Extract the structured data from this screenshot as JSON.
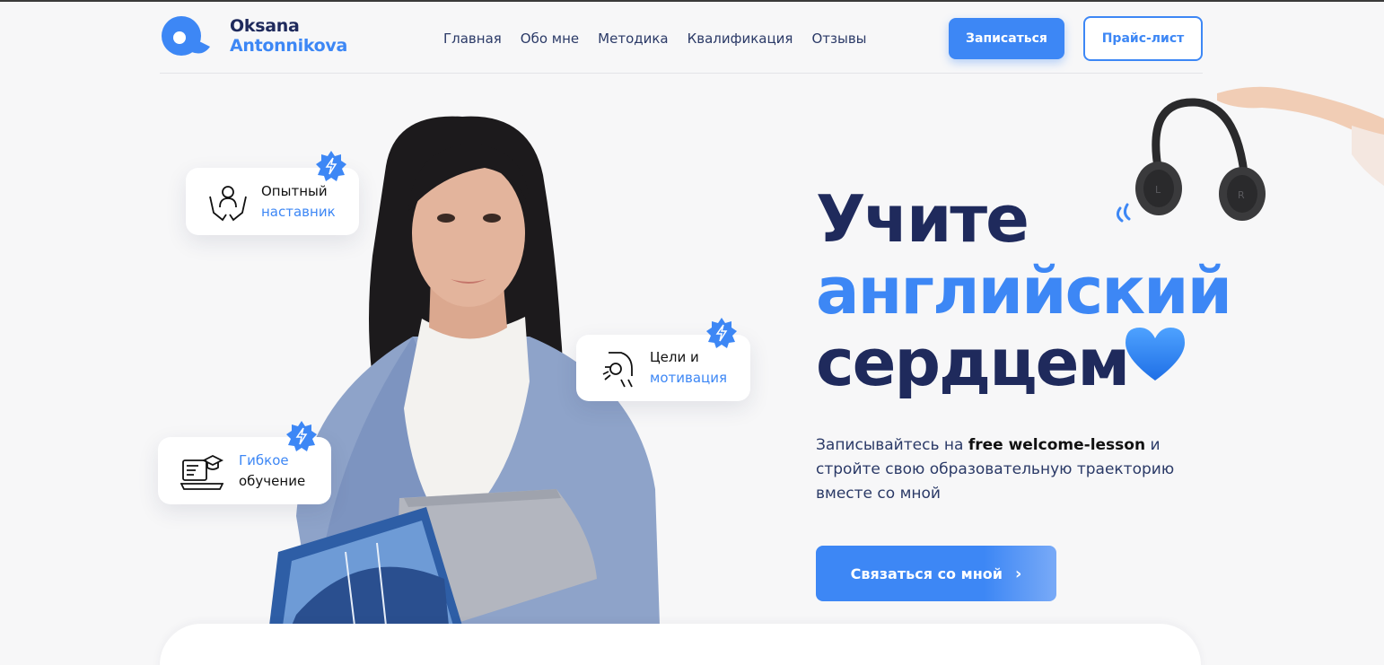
{
  "brand": {
    "line1": "Oksana",
    "line2": "Antonnikova"
  },
  "nav": [
    "Главная",
    "Обо мне",
    "Методика",
    "Квалификация",
    "Отзывы"
  ],
  "header": {
    "signup_label": "Записаться",
    "pricelist_label": "Прайс-лист"
  },
  "features": [
    {
      "line1": "Опытный",
      "line2": "наставник",
      "icon": "mentor-icon"
    },
    {
      "line1": "Цели и",
      "line2": "мотивация",
      "icon": "goals-icon"
    },
    {
      "line1": "Гибкое",
      "line2": "обучение",
      "icon": "flexible-learning-icon"
    }
  ],
  "hero": {
    "title_line1": "Учите",
    "title_line2": "английский",
    "title_line3": "сердцем",
    "desc_pre": "Записывайтесь на ",
    "desc_bold": "free welcome-lesson",
    "desc_post": " и стройте свою образовательную траекторию вместе со мной",
    "cta_label": "Связаться со мной"
  },
  "colors": {
    "accent": "#3d87f5",
    "dark": "#1f2a5c",
    "background": "#f7f7f8"
  }
}
